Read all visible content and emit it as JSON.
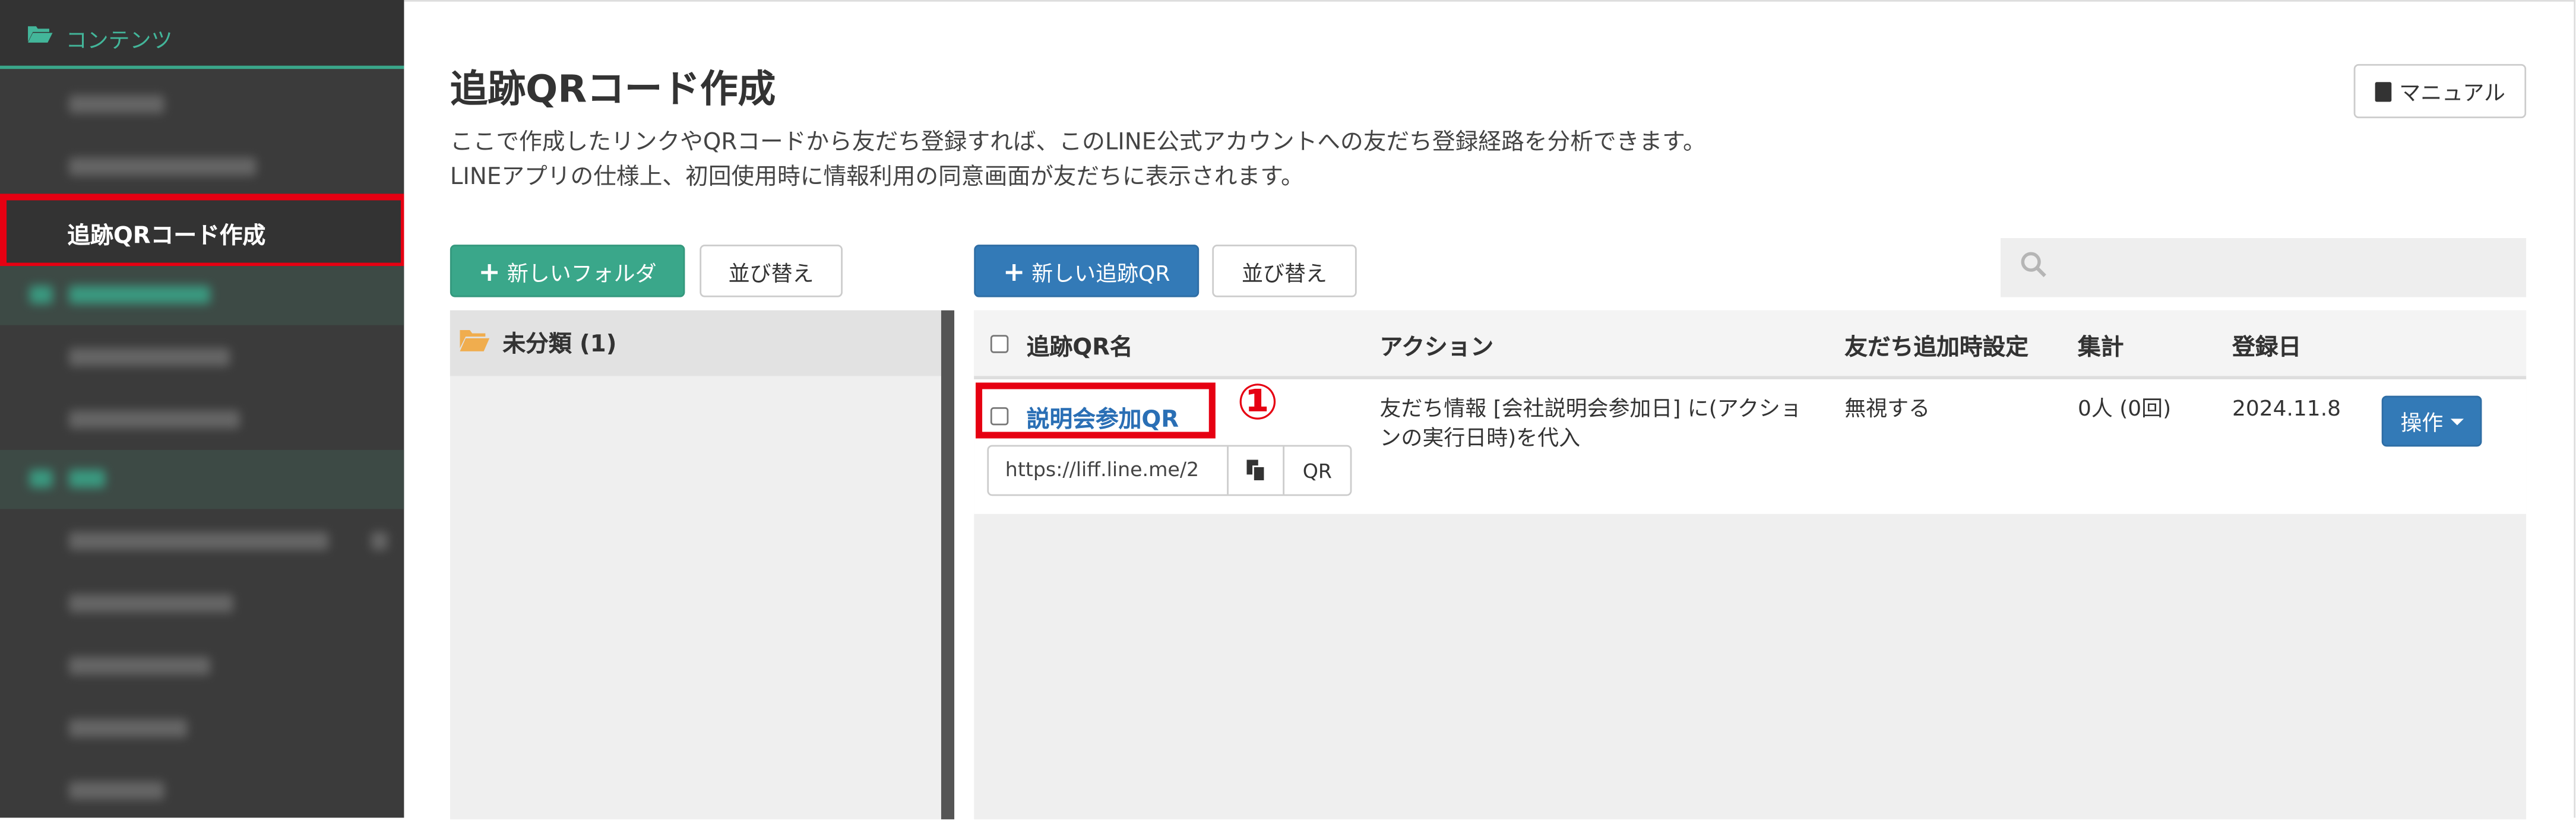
{
  "sidebar": {
    "section_label": "コンテンツ",
    "active_item": "追跡QRコード作成"
  },
  "header": {
    "title": "追跡QRコード作成",
    "desc_line1": "ここで作成したリンクやQRコードから友だち登録すれば、このLINE公式アカウントへの友だち登録経路を分析できます。",
    "desc_line2": "LINEアプリの仕様上、初回使用時に情報利用の同意画面が友だちに表示されます。",
    "manual_label": "マニュアル"
  },
  "folders": {
    "new_folder_label": "新しいフォルダ",
    "sort_label": "並び替え",
    "items": [
      {
        "label": "未分類 (1)"
      }
    ]
  },
  "toolbar": {
    "new_qr_label": "新しい追跡QR",
    "sort_label": "並び替え",
    "search_placeholder": ""
  },
  "table": {
    "columns": [
      "追跡QR名",
      "アクション",
      "友だち追加時設定",
      "集計",
      "登録日"
    ],
    "rows": [
      {
        "name": "説明会参加QR",
        "url": "https://liff.line.me/2",
        "qr_button": "QR",
        "action_line1": "友だち情報 [会社説明会参加日] に(アクショ",
        "action_line2": "ンの実行日時)を代入",
        "add_setting": "無視する",
        "count": "0人 (0回)",
        "date": "2024.11.8",
        "op_label": "操作"
      }
    ]
  },
  "annotation": {
    "marker": "①"
  },
  "colors": {
    "green": "#3aa78a",
    "blue": "#337ab7",
    "highlight": "#e60012",
    "link": "#2a6fb5"
  }
}
